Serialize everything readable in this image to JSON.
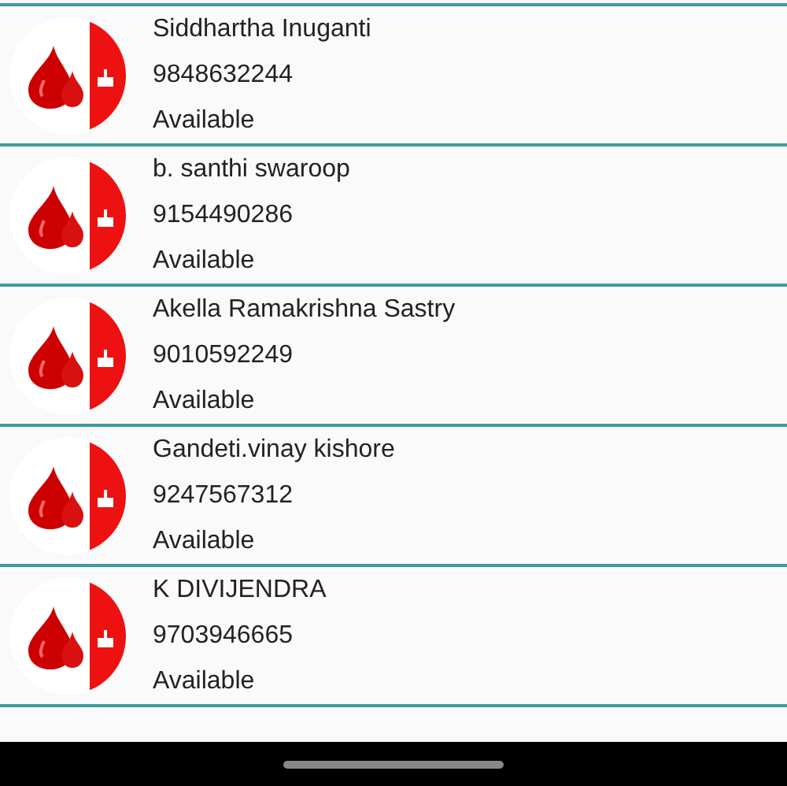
{
  "donors": [
    {
      "name": "Siddhartha Inuganti",
      "phone": "9848632244",
      "status": "Available"
    },
    {
      "name": "b. santhi swaroop",
      "phone": "9154490286",
      "status": "Available"
    },
    {
      "name": "Akella Ramakrishna Sastry",
      "phone": "9010592249",
      "status": "Available"
    },
    {
      "name": "Gandeti.vinay kishore",
      "phone": "9247567312",
      "status": "Available"
    },
    {
      "name": "K DIVIJENDRA",
      "phone": "9703946665",
      "status": "Available"
    }
  ]
}
